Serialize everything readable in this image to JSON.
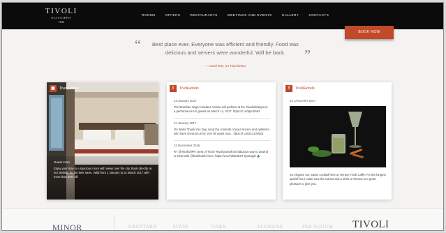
{
  "header": {
    "logo_line1": "TIVOLI",
    "logo_line2": "OLISSIPPO",
    "logo_line3": "1933",
    "nav": [
      "ROOMS",
      "OFFERS",
      "RESTAURANTS",
      "MEETINGS AND EVENTS",
      "GALLERY",
      "CONTACTS"
    ],
    "book_label": "BOOK NOW"
  },
  "testimonial": {
    "open_mark": "“",
    "close_mark": "”",
    "text": "Best place ever. Everyone was efficient and friendly. Food was delicious and servers were wonderful. Will be back.",
    "author": "— Carol M D, on TripAdvisor"
  },
  "cards": {
    "photo": {
      "badge": "▣",
      "title": "TivoliHotels",
      "caption_head": "Guest room",
      "caption": "Enjoy your stay in a spacious room with views over the city. Book directly on our website for the best rates. Valid from 1 January to 31 March 2017 with more than 20% off."
    },
    "twitter": {
      "badge": "t",
      "title": "TivoliHotels",
      "tweets": [
        {
          "date": "13 January 2017",
          "text": "The Brazilian singer Caetano Veloso will perform at the #tivoliolissippo in a performance for guests on March 14, 2017. https://t.co/8pxJ5hk3"
        },
        {
          "date": "11 January 2017",
          "text": "On World Thank You Day, send the contents of your sincere and optimism who have cheered us for over 80 years now... https://t.co/DCx1rWrZ8"
        },
        {
          "date": "22 December 2016",
          "text": "RT @TivoliOliPR: Best of Tivoli: #tivolioceanfront fabulous way to unwind in 2016 with @tivolihotels here. https://t.co/7d8w2EHl #portugal 🎄"
        }
      ]
    },
    "facebook": {
      "badge": "f",
      "title": "TivoliHotels",
      "date": "22 JANUARY 2017",
      "text": "So elegant, our Garbo cocktail here at Terrace Tivoli Caffe! For the longest aperitif hour make sure the sunset and a drink at Terrace is a great pleasure to give you."
    }
  },
  "brands": {
    "minor": "MINOR",
    "faint": [
      "ANANTARA",
      "AVANI",
      "OAKS",
      "ELEWANA",
      "PER AQUUM"
    ],
    "tivoli": "TIVOLI"
  },
  "colors": {
    "accent": "#c2492a",
    "topbar": "#0b0b0b",
    "page_bg": "#f4f3f1"
  }
}
